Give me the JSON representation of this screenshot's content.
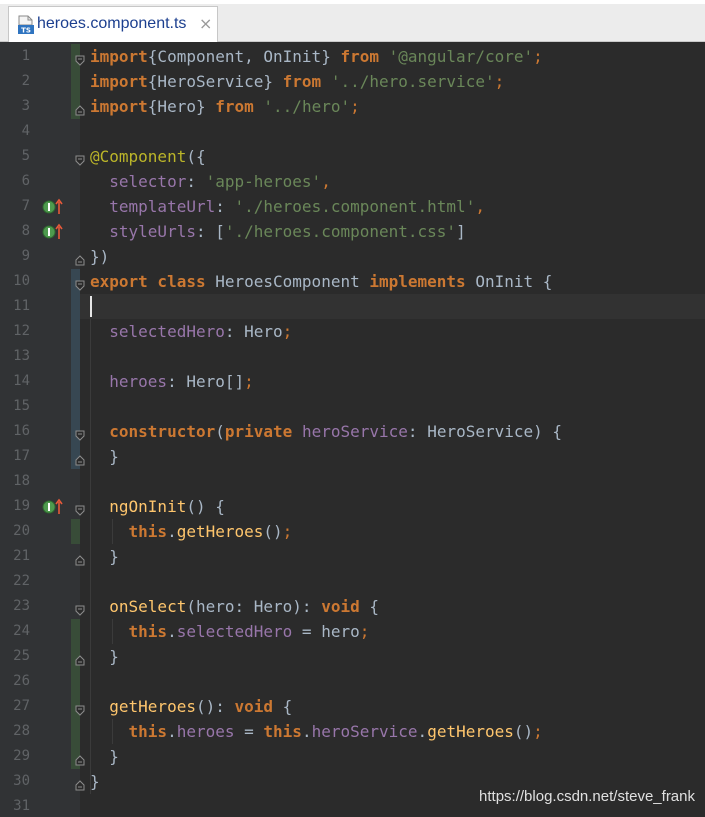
{
  "tab": {
    "icon": "typescript-file-icon",
    "label": "heroes.component.ts",
    "close": "×"
  },
  "line_numbers": [
    "1",
    "2",
    "3",
    "4",
    "5",
    "6",
    "7",
    "8",
    "9",
    "10",
    "11",
    "12",
    "13",
    "14",
    "15",
    "16",
    "17",
    "18",
    "19",
    "20",
    "21",
    "22",
    "23",
    "24",
    "25",
    "26",
    "27",
    "28",
    "29",
    "30",
    "31"
  ],
  "code": [
    [
      [
        "k",
        "import"
      ],
      [
        "",
        "{Component, OnInit} "
      ],
      [
        "k",
        "from"
      ],
      [
        "",
        " "
      ],
      [
        "s",
        "'@angular/core'"
      ],
      [
        "p",
        ";"
      ]
    ],
    [
      [
        "k",
        "import"
      ],
      [
        "",
        "{HeroService} "
      ],
      [
        "k",
        "from"
      ],
      [
        "",
        " "
      ],
      [
        "s",
        "'../hero.service'"
      ],
      [
        "p",
        ";"
      ]
    ],
    [
      [
        "k",
        "import"
      ],
      [
        "",
        "{Hero} "
      ],
      [
        "k",
        "from"
      ],
      [
        "",
        " "
      ],
      [
        "s",
        "'../hero'"
      ],
      [
        "p",
        ";"
      ]
    ],
    [],
    [
      [
        "a",
        "@Component"
      ],
      [
        "",
        "({"
      ]
    ],
    [
      [
        "",
        "  "
      ],
      [
        "f",
        "selector"
      ],
      [
        "",
        ": "
      ],
      [
        "s",
        "'app-heroes'"
      ],
      [
        "p",
        ","
      ]
    ],
    [
      [
        "",
        "  "
      ],
      [
        "f",
        "templateUrl"
      ],
      [
        "",
        ": "
      ],
      [
        "s",
        "'./heroes.component.html'"
      ],
      [
        "p",
        ","
      ]
    ],
    [
      [
        "",
        "  "
      ],
      [
        "f",
        "styleUrls"
      ],
      [
        "",
        ": ["
      ],
      [
        "s",
        "'./heroes.component.css'"
      ],
      [
        "",
        "]"
      ]
    ],
    [
      [
        "",
        "})"
      ]
    ],
    [
      [
        "k",
        "export class"
      ],
      [
        "",
        " HeroesComponent "
      ],
      [
        "k",
        "implements"
      ],
      [
        "",
        " OnInit {"
      ]
    ],
    [],
    [
      [
        "",
        "  "
      ],
      [
        "f",
        "selectedHero"
      ],
      [
        "",
        ": Hero"
      ],
      [
        "p",
        ";"
      ]
    ],
    [],
    [
      [
        "",
        "  "
      ],
      [
        "f",
        "heroes"
      ],
      [
        "",
        ": Hero[]"
      ],
      [
        "p",
        ";"
      ]
    ],
    [],
    [
      [
        "",
        "  "
      ],
      [
        "k",
        "constructor"
      ],
      [
        "",
        "("
      ],
      [
        "k",
        "private"
      ],
      [
        "",
        " "
      ],
      [
        "f",
        "heroService"
      ],
      [
        "",
        ": HeroService) {"
      ]
    ],
    [
      [
        "",
        "  }"
      ]
    ],
    [],
    [
      [
        "",
        "  "
      ],
      [
        "m",
        "ngOnInit"
      ],
      [
        "",
        "() {"
      ]
    ],
    [
      [
        "",
        "    "
      ],
      [
        "k",
        "this"
      ],
      [
        "",
        "."
      ],
      [
        "m",
        "getHeroes"
      ],
      [
        "",
        "()"
      ],
      [
        "p",
        ";"
      ]
    ],
    [
      [
        "",
        "  }"
      ]
    ],
    [],
    [
      [
        "",
        "  "
      ],
      [
        "m",
        "onSelect"
      ],
      [
        "",
        "(hero: Hero): "
      ],
      [
        "k",
        "void"
      ],
      [
        "",
        " {"
      ]
    ],
    [
      [
        "",
        "    "
      ],
      [
        "k",
        "this"
      ],
      [
        "",
        "."
      ],
      [
        "f",
        "selectedHero"
      ],
      [
        "",
        " = hero"
      ],
      [
        "p",
        ";"
      ]
    ],
    [
      [
        "",
        "  }"
      ]
    ],
    [],
    [
      [
        "",
        "  "
      ],
      [
        "m",
        "getHeroes"
      ],
      [
        "",
        "(): "
      ],
      [
        "k",
        "void"
      ],
      [
        "",
        " {"
      ]
    ],
    [
      [
        "",
        "    "
      ],
      [
        "k",
        "this"
      ],
      [
        "",
        "."
      ],
      [
        "f",
        "heroes"
      ],
      [
        "",
        " = "
      ],
      [
        "k",
        "this"
      ],
      [
        "",
        "."
      ],
      [
        "f",
        "heroService"
      ],
      [
        "",
        "."
      ],
      [
        "m",
        "getHeroes"
      ],
      [
        "",
        "()"
      ],
      [
        "p",
        ";"
      ]
    ],
    [
      [
        "",
        "  }"
      ]
    ],
    [
      [
        "",
        "}"
      ]
    ],
    []
  ],
  "gutter_icons": [
    {
      "line": 7,
      "icon": "implements-override-icon"
    },
    {
      "line": 8,
      "icon": "implements-override-icon"
    },
    {
      "line": 19,
      "icon": "implements-override-icon"
    }
  ],
  "colors": {
    "background": "#2b2b2b",
    "gutter": "#313335",
    "keyword": "#cc7832",
    "string": "#6a8759",
    "annotation": "#bbb529",
    "field": "#9876aa",
    "method": "#ffc66d",
    "text": "#a9b7c6"
  },
  "watermark": "https://blog.csdn.net/steve_frank"
}
